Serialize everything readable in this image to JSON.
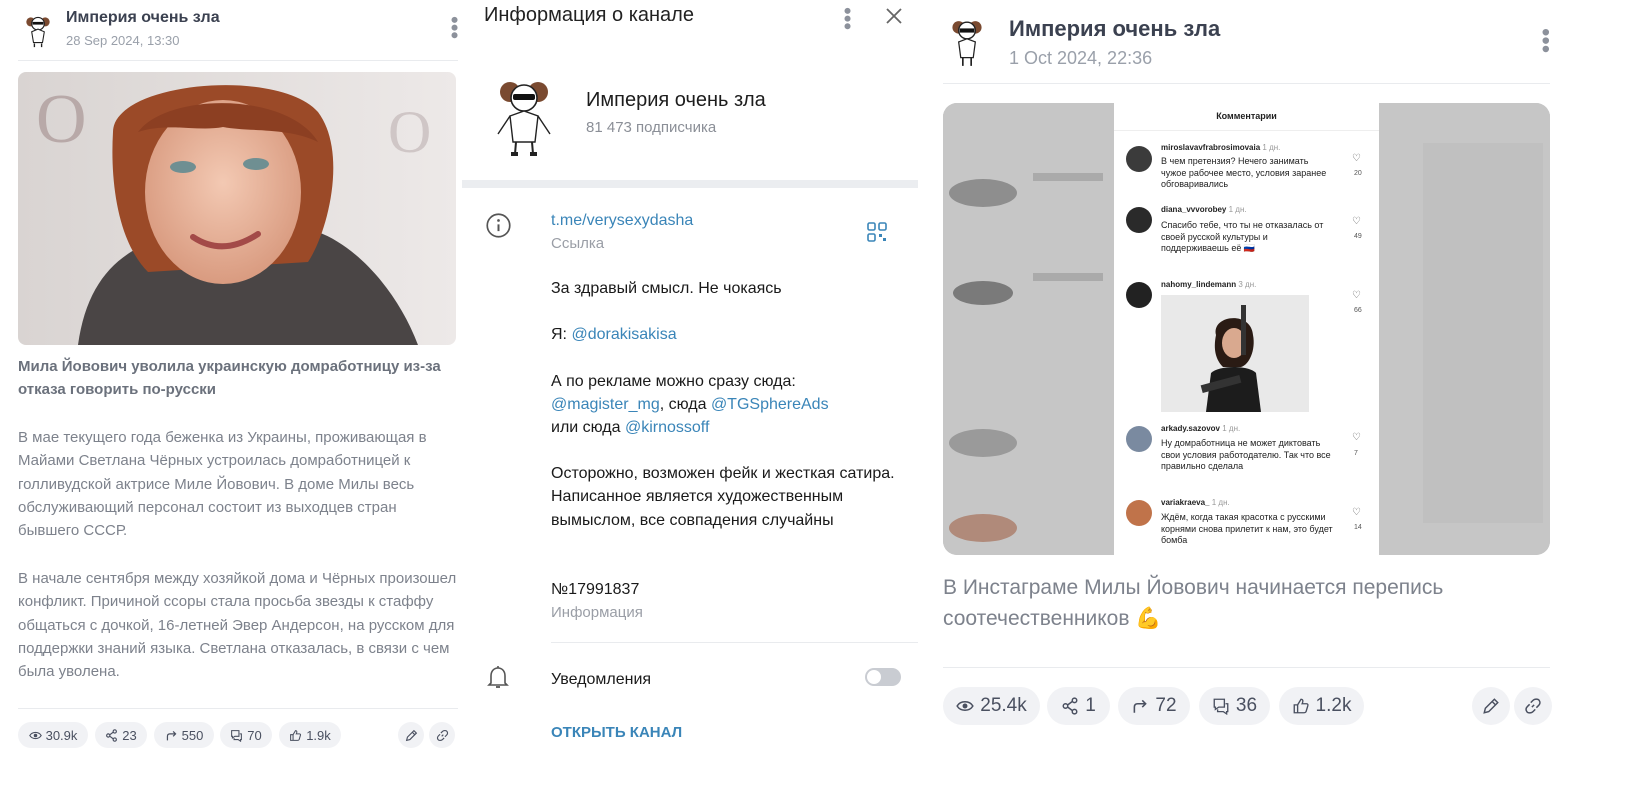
{
  "left_post": {
    "channel_name": "Империя очень зла",
    "date": "28 Sep 2024, 13:30",
    "headline": "Мила Йовович уволила украинскую домработницу из-за отказа говорить по-русски",
    "paragraphs": [
      "В мае текущего года беженка из Украины, проживающая в Майами Светлана Чёрных устроилась домработницей к голливудской актрисе Миле Йовович. В доме Милы весь обслуживающий персонал состоит из выходцев стран бывшего СССР.",
      "В начале сентября между хозяйкой дома и Чёрных произошел конфликт. Причиной ссоры стала просьба звезды к стаффу общаться с дочкой, 16-летней Эвер Андерсон, на русском для поддержки знаний языка. Светлана отказалась, в связи с чем была уволена."
    ],
    "stats": {
      "views": "30.9k",
      "shares": "23",
      "forwards": "550",
      "comments": "70",
      "reactions": "1.9k"
    }
  },
  "channel_info": {
    "header_title": "Информация о канале",
    "channel_name": "Империя очень зла",
    "subscribers": "81 473 подписчика",
    "link": "t.me/verysexydasha",
    "link_label": "Ссылка",
    "description": {
      "line1": "За здравый смысл. Не чокаясь",
      "me_prefix": "Я: ",
      "me_handle": "@dorakisakisa",
      "ads_line": "А по рекламе можно сразу сюда:",
      "ads_h1": "@magister_mg",
      "ads_mid": ", сюда ",
      "ads_h2": "@TGSphereAds",
      "ads_or": "или сюда ",
      "ads_h3": "@kirnossoff",
      "disclaimer": "Осторожно, возможен фейк и жесткая сатира. Написанное является художественным вымыслом, все совпадения случайны"
    },
    "number": "№17991837",
    "number_label": "Информация",
    "notifications_label": "Уведомления",
    "notifications_on": false,
    "open_channel_button": "ОТКРЫТЬ КАНАЛ"
  },
  "right_post": {
    "channel_name": "Империя очень зла",
    "date": "1 Oct 2024, 22:36",
    "caption": "В Инстаграме Милы Йовович начинается перепись соотечественников",
    "caption_emoji": "💪",
    "stats": {
      "views": "25.4k",
      "shares": "1",
      "forwards": "72",
      "comments": "36",
      "reactions": "1.2k"
    },
    "screenshot": {
      "title": "Комментарии",
      "comments": [
        {
          "user": "miroslavavfrabrosimovaia",
          "time": "1 дн.",
          "text": "В чем претензия? Нечего занимать чужое рабочее место, условия заранее обговаривались",
          "likes": "20"
        },
        {
          "user": "diana_vvvorobey",
          "time": "1 дн.",
          "text": "Спасибо тебе, что ты не отказалась от своей русской культуры и поддерживаешь её 🇷🇺",
          "likes": "49"
        },
        {
          "user": "nahomy_lindemann",
          "time": "3 дн.",
          "text": "",
          "likes": "66"
        },
        {
          "user": "arkady.sazovov",
          "time": "1 дн.",
          "text": "Ну домработница не может диктовать свои условия работодателю. Так что все правильно сделала",
          "likes": "7"
        },
        {
          "user": "variakraeva_",
          "time": "1 дн.",
          "text": "Ждём, когда такая красотка с русскими корнями снова прилетит к нам, это будет бомба",
          "likes": "14"
        }
      ]
    }
  },
  "colors": {
    "link": "#3a85b8",
    "pill_bg": "#f1f2f5",
    "muted": "#7d828c"
  }
}
